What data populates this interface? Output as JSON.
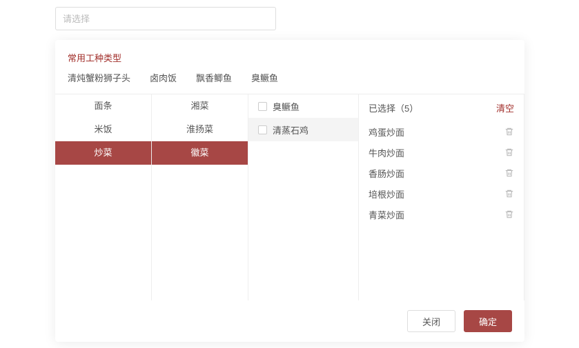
{
  "input": {
    "placeholder": "请选择"
  },
  "section_title": "常用工种类型",
  "top_tags": [
    "清炖蟹粉狮子头",
    "卤肉饭",
    "飘香鲫鱼",
    "臭鳜鱼"
  ],
  "col1": [
    {
      "label": "面条",
      "selected": false
    },
    {
      "label": "米饭",
      "selected": false
    },
    {
      "label": "炒菜",
      "selected": true
    }
  ],
  "col2": [
    {
      "label": "湘菜",
      "selected": false
    },
    {
      "label": "淮扬菜",
      "selected": false
    },
    {
      "label": "徽菜",
      "selected": true
    }
  ],
  "col3": [
    {
      "label": "臭鳜鱼",
      "hover": false
    },
    {
      "label": "清蒸石鸡",
      "hover": true
    }
  ],
  "selected_header": {
    "prefix": "已选择（",
    "count": "5",
    "suffix": "）",
    "clear": "清空"
  },
  "selected": [
    "鸡蛋炒面",
    "牛肉炒面",
    "香肠炒面",
    "培根炒面",
    "青菜炒面"
  ],
  "footer": {
    "close": "关闭",
    "confirm": "确定"
  }
}
